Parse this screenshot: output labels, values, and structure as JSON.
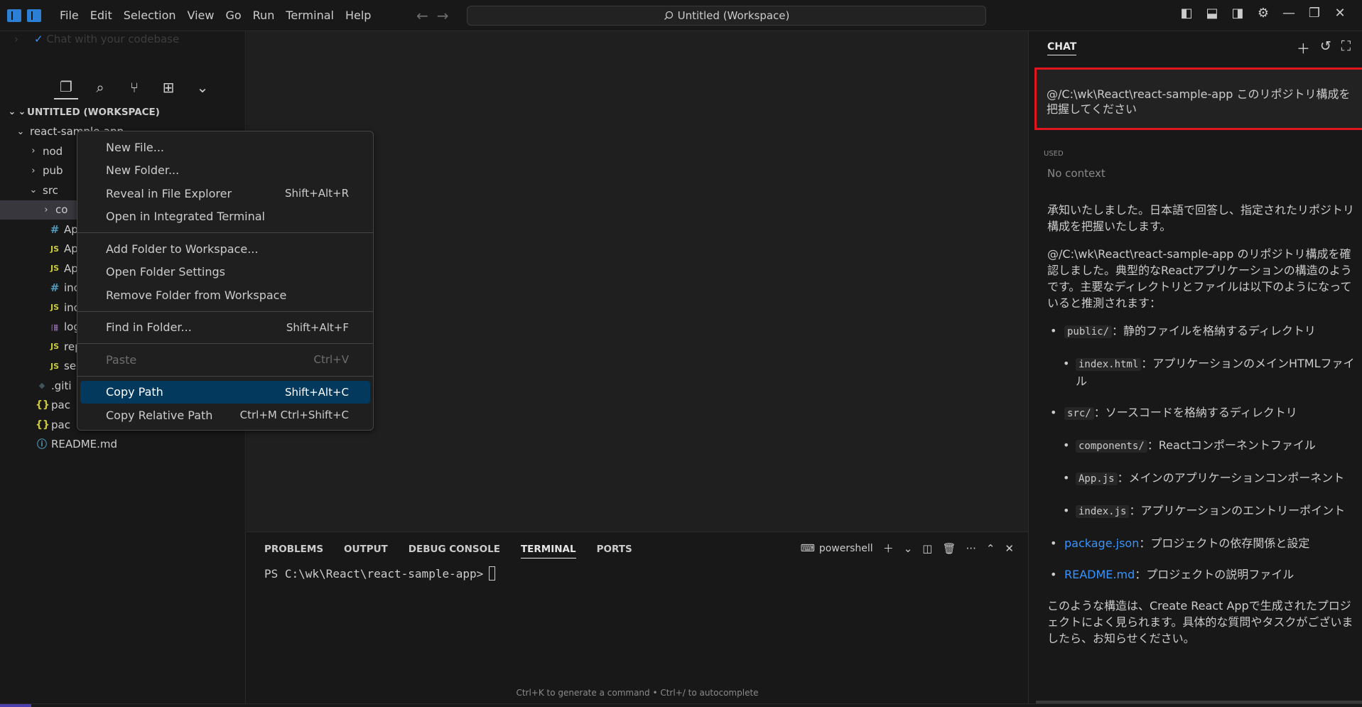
{
  "titlebar": {
    "menu": [
      "File",
      "Edit",
      "Selection",
      "View",
      "Go",
      "Run",
      "Terminal",
      "Help"
    ],
    "search_text": "Untitled (Workspace)"
  },
  "sidebar": {
    "faded_text": "Chat with your codebase",
    "workspace_label": "UNTITLED (WORKSPACE)",
    "tree": [
      {
        "label": "react-sample-app",
        "depth": 1,
        "chev": "v",
        "icon": ""
      },
      {
        "label": "nod",
        "depth": 2,
        "chev": ">",
        "icon": ""
      },
      {
        "label": "pub",
        "depth": 2,
        "chev": ">",
        "icon": ""
      },
      {
        "label": "src",
        "depth": 2,
        "chev": "v",
        "icon": ""
      },
      {
        "label": "co",
        "depth": 3,
        "chev": ">",
        "icon": "",
        "selected": true
      },
      {
        "label": "Ap",
        "depth": 3,
        "chev": "",
        "icon": "hash"
      },
      {
        "label": "Ap",
        "depth": 3,
        "chev": "",
        "icon": "js"
      },
      {
        "label": "Ap",
        "depth": 3,
        "chev": "",
        "icon": "js"
      },
      {
        "label": "inc",
        "depth": 3,
        "chev": "",
        "icon": "hash"
      },
      {
        "label": "inc",
        "depth": 3,
        "chev": "",
        "icon": "js"
      },
      {
        "label": "log",
        "depth": 3,
        "chev": "",
        "icon": "logo"
      },
      {
        "label": "rep",
        "depth": 3,
        "chev": "",
        "icon": "js"
      },
      {
        "label": "se",
        "depth": 3,
        "chev": "",
        "icon": "js"
      },
      {
        "label": ".giti",
        "depth": 2,
        "chev": "",
        "icon": "git"
      },
      {
        "label": "pac",
        "depth": 2,
        "chev": "",
        "icon": "json"
      },
      {
        "label": "pac",
        "depth": 2,
        "chev": "",
        "icon": "json"
      },
      {
        "label": "README.md",
        "depth": 2,
        "chev": "",
        "icon": "info"
      }
    ]
  },
  "context_menu": {
    "groups": [
      [
        {
          "label": "New File...",
          "shortcut": ""
        },
        {
          "label": "New Folder...",
          "shortcut": ""
        },
        {
          "label": "Reveal in File Explorer",
          "shortcut": "Shift+Alt+R"
        },
        {
          "label": "Open in Integrated Terminal",
          "shortcut": ""
        }
      ],
      [
        {
          "label": "Add Folder to Workspace...",
          "shortcut": ""
        },
        {
          "label": "Open Folder Settings",
          "shortcut": ""
        },
        {
          "label": "Remove Folder from Workspace",
          "shortcut": ""
        }
      ],
      [
        {
          "label": "Find in Folder...",
          "shortcut": "Shift+Alt+F"
        }
      ],
      [
        {
          "label": "Paste",
          "shortcut": "Ctrl+V",
          "disabled": true
        }
      ],
      [
        {
          "label": "Copy Path",
          "shortcut": "Shift+Alt+C",
          "highlighted": true
        },
        {
          "label": "Copy Relative Path",
          "shortcut": "Ctrl+M Ctrl+Shift+C"
        }
      ]
    ]
  },
  "panel": {
    "tabs": [
      "PROBLEMS",
      "OUTPUT",
      "DEBUG CONSOLE",
      "TERMINAL",
      "PORTS"
    ],
    "active_tab": "TERMINAL",
    "shell": "powershell",
    "prompt": "PS C:\\wk\\React\\react-sample-app>",
    "hint": "Ctrl+K to generate a command • Ctrl+/ to autocomplete"
  },
  "chat": {
    "title": "CHAT",
    "query": "@/C:\\wk\\React\\react-sample-app このリポジトリ構成を把握してください",
    "used_label": "USED",
    "no_context": "No context",
    "p1": "承知いたしました。日本語で回答し、指定されたリポジトリ構成を把握いたします。",
    "p2": "@/C:\\wk\\React\\react-sample-app のリポジトリ構成を確認しました。典型的なReactアプリケーションの構造のようです。主要なディレクトリとファイルは以下のようになっていると推測されます：",
    "items": [
      {
        "code": "public/",
        "text": "：静的ファイルを格納するディレクトリ",
        "level": 1
      },
      {
        "code": "index.html",
        "text": "：アプリケーションのメインHTMLファイル",
        "level": 2
      },
      {
        "code": "src/",
        "text": "：ソースコードを格納するディレクトリ",
        "level": 1
      },
      {
        "code": "components/",
        "text": "：Reactコンポーネントファイル",
        "level": 2
      },
      {
        "code": "App.js",
        "text": "：メインのアプリケーションコンポーネント",
        "level": 2
      },
      {
        "code": "index.js",
        "text": "：アプリケーションのエントリーポイント",
        "level": 2
      },
      {
        "link": "package.json",
        "text": "：プロジェクトの依存関係と設定",
        "level": 1
      },
      {
        "link": "README.md",
        "text": "：プロジェクトの説明ファイル",
        "level": 1
      }
    ],
    "p3": "このような構造は、Create React Appで生成されたプロジェクトによく見られます。具体的な質問やタスクがございましたら、お知らせください。"
  }
}
